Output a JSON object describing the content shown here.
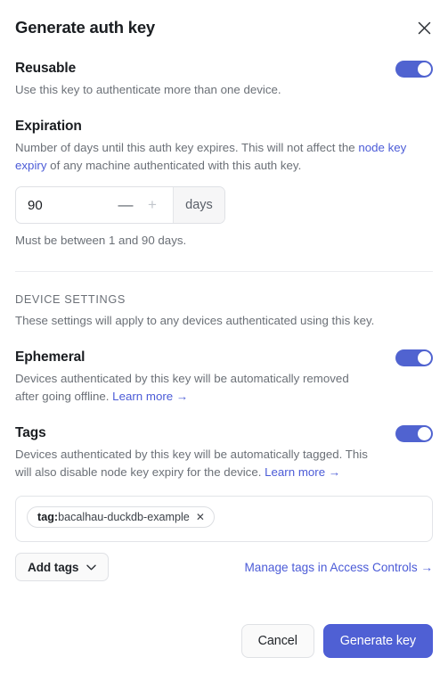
{
  "dialog": {
    "title": "Generate auth key",
    "close_icon": "close-icon"
  },
  "reusable": {
    "label": "Reusable",
    "helper": "Use this key to authenticate more than one device.",
    "enabled": true
  },
  "expiration": {
    "label": "Expiration",
    "helper_part1": "Number of days until this auth key expires. This will not affect the ",
    "helper_link": "node key expiry",
    "helper_part2": " of any machine authenticated with this auth key.",
    "value": "90",
    "placeholder": "90",
    "decrement_label": "—",
    "increment_label": "+",
    "unit": "days",
    "hint": "Must be between 1 and 90 days."
  },
  "device_settings": {
    "heading": "DEVICE SETTINGS",
    "subtitle": "These settings will apply to any devices authenticated using this key."
  },
  "ephemeral": {
    "label": "Ephemeral",
    "helper": "Devices authenticated by this key will be automatically removed after going offline. ",
    "learn_more": "Learn more →",
    "enabled": true
  },
  "tags": {
    "label": "Tags",
    "helper": "Devices authenticated by this key will be automatically tagged. This will also disable node key expiry for the device. ",
    "learn_more": "Learn more →",
    "enabled": true,
    "chips": [
      {
        "prefix": "tag:",
        "name": "bacalhau-duckdb-example",
        "remove_icon": "✕"
      }
    ],
    "add_tags_label": "Add tags",
    "chevron_icon": "chevron-down-icon",
    "manage_link": "Manage tags in Access Controls →"
  },
  "footer": {
    "cancel_label": "Cancel",
    "primary_label": "Generate key"
  },
  "colors": {
    "accent": "#4b5bd7",
    "toggle_on": "#5063d0",
    "primary_button": "#4f60d4",
    "text": "#1a1d21",
    "muted_text": "#6b7077",
    "border": "#dfe1e5"
  }
}
